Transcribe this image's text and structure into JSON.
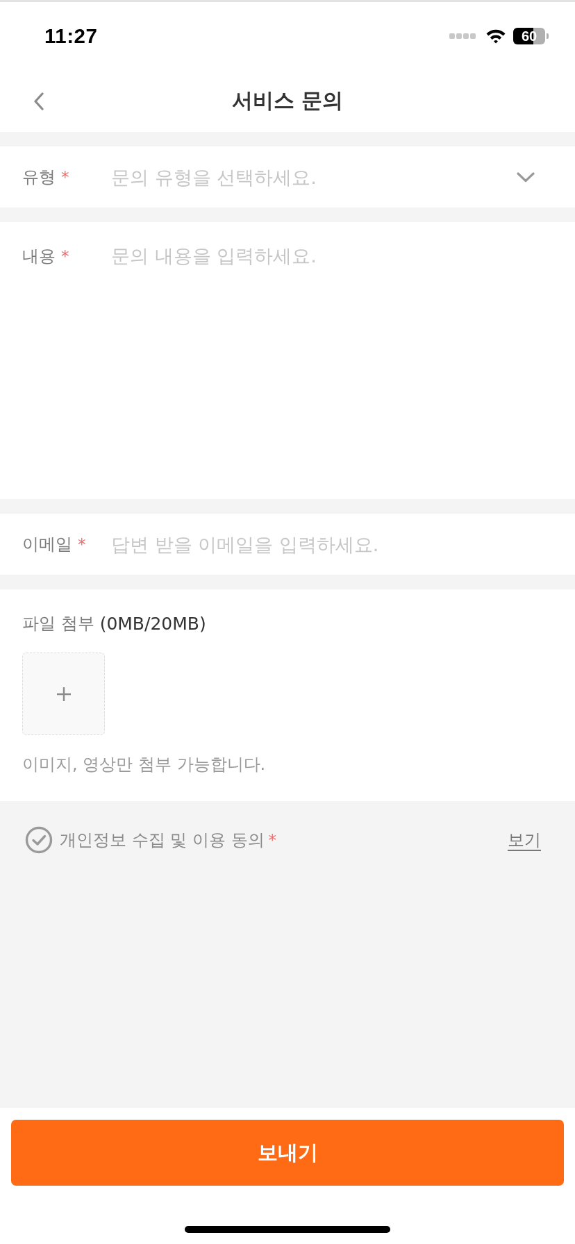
{
  "status_bar": {
    "time": "11:27",
    "battery": "60"
  },
  "header": {
    "title": "서비스 문의"
  },
  "fields": [
    {
      "kind": "select",
      "label": "유형",
      "required_mark": "*",
      "placeholder": "문의 유형을 선택하세요."
    },
    {
      "kind": "textarea",
      "label": "내용",
      "required_mark": "*",
      "placeholder": "문의 내용을 입력하세요."
    },
    {
      "kind": "input",
      "label": "이메일",
      "required_mark": "*",
      "placeholder": "답변 받을 이메일을 입력하세요."
    }
  ],
  "attachment": {
    "label": "파일 첨부",
    "size": "(0MB/20MB)",
    "hint": "이미지, 영상만 첨부 가능합니다."
  },
  "consent": {
    "label": "개인정보 수집 및 이용 동의",
    "required_mark": "*",
    "checked": false,
    "link": "보기"
  },
  "submit_button": "보내기"
}
